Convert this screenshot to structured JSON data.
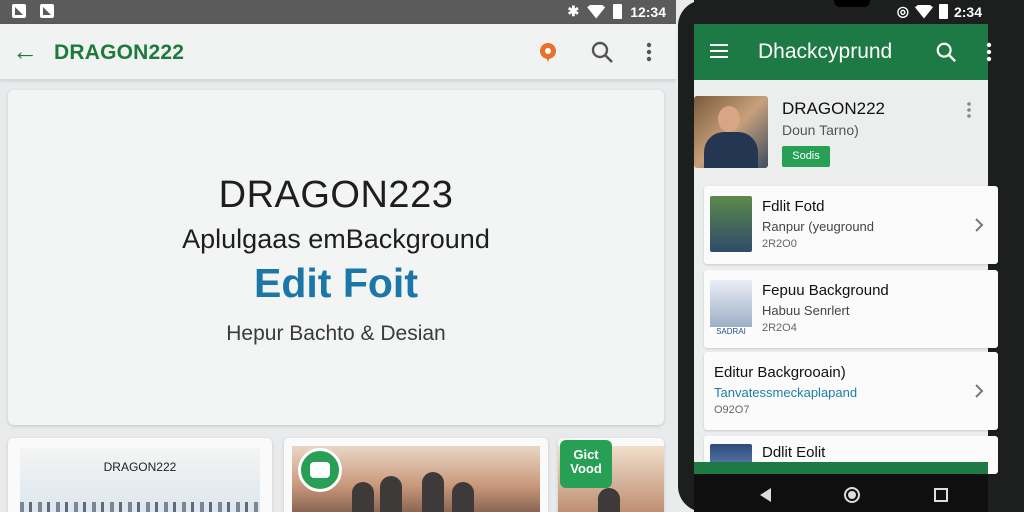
{
  "tablet": {
    "statusbar": {
      "time": "12:34"
    },
    "appbar": {
      "title": "DRAGON222"
    },
    "hero": {
      "title": "DRAGON223",
      "subtitle": "Aplulgaas emBackground",
      "accent": "Edit Foit",
      "caption": "Hepur Bachto & Desian"
    },
    "thumbs": [
      {
        "label": "DRAGON222"
      },
      {
        "badge": ""
      },
      {
        "badge": "Gict Vood"
      }
    ]
  },
  "phone": {
    "statusbar": {
      "time": "2:34"
    },
    "appbar": {
      "title": "Dhackcyprund"
    },
    "profile": {
      "name": "DRAGON222",
      "subtitle": "Doun Tarno)",
      "badge": "Sodis"
    },
    "cards": [
      {
        "title": "Fdlit Fotd",
        "subtitle": "Ranpur (yeuground",
        "meta": "2R2O0"
      },
      {
        "title": "Fepuu Background",
        "subtitle": "Habuu Senrlert",
        "meta": "2R2O4",
        "thumb_label": "SADRAI"
      },
      {
        "title": "Editur Backgrooain)",
        "subtitle": "Tanvatessmeckaplapand",
        "meta": "O92O7"
      },
      {
        "title": "Ddlit Eolit"
      }
    ]
  },
  "colors": {
    "brand_green": "#1e7a45",
    "accent_blue": "#1b77a8",
    "badge_green": "#27a055"
  }
}
